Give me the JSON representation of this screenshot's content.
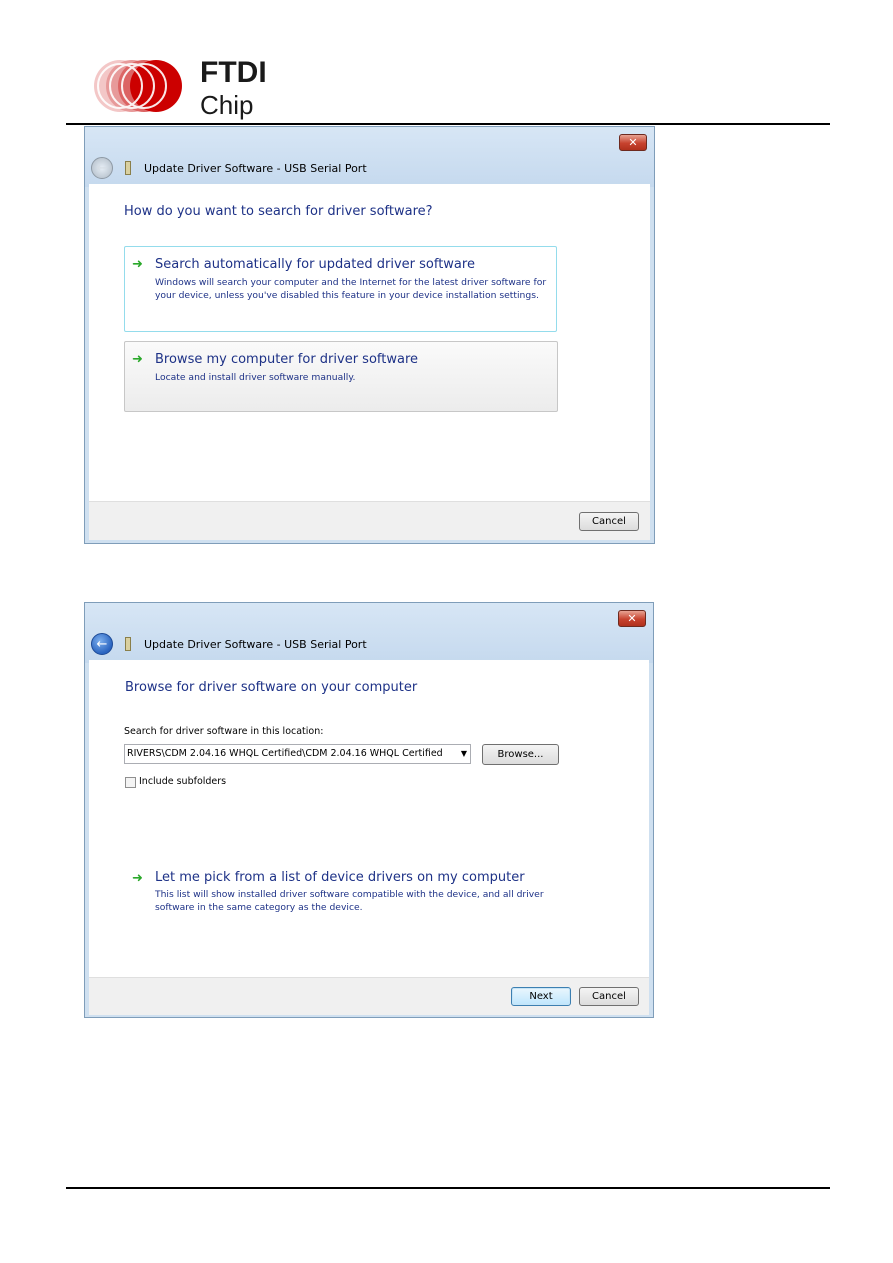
{
  "logo": {
    "line1": "FTDI",
    "line2": "Chip",
    "accent": "#cc0000"
  },
  "window1": {
    "title": "Update Driver Software - USB Serial Port",
    "close_glyph": "✕",
    "heading": "How do you want to search for driver software?",
    "option1": {
      "title": "Search automatically for updated driver software",
      "desc": "Windows will search your computer and the Internet for the latest driver software for your device, unless you've disabled this feature in your device installation settings."
    },
    "option2": {
      "title": "Browse my computer for driver software",
      "desc": "Locate and install driver software manually."
    },
    "cancel_label": "Cancel"
  },
  "window2": {
    "title": "Update Driver Software - USB Serial Port",
    "close_glyph": "✕",
    "heading": "Browse for driver software on your computer",
    "search_label": "Search for driver software in this location:",
    "path_value": "RIVERS\\CDM 2.04.16 WHQL Certified\\CDM 2.04.16 WHQL Certified",
    "browse_label": "Browse...",
    "include_subfolders_label": "Include subfolders",
    "include_subfolders_checked": false,
    "pick_title": "Let me pick from a list of device drivers on my computer",
    "pick_desc": "This list will show installed driver software compatible with the device, and all driver software in the same category as the device.",
    "next_label": "Next",
    "cancel_label": "Cancel"
  },
  "icons": {
    "arrow": "green-arrow-icon",
    "back": "back-arrow-icon",
    "device": "usb-device-icon"
  }
}
